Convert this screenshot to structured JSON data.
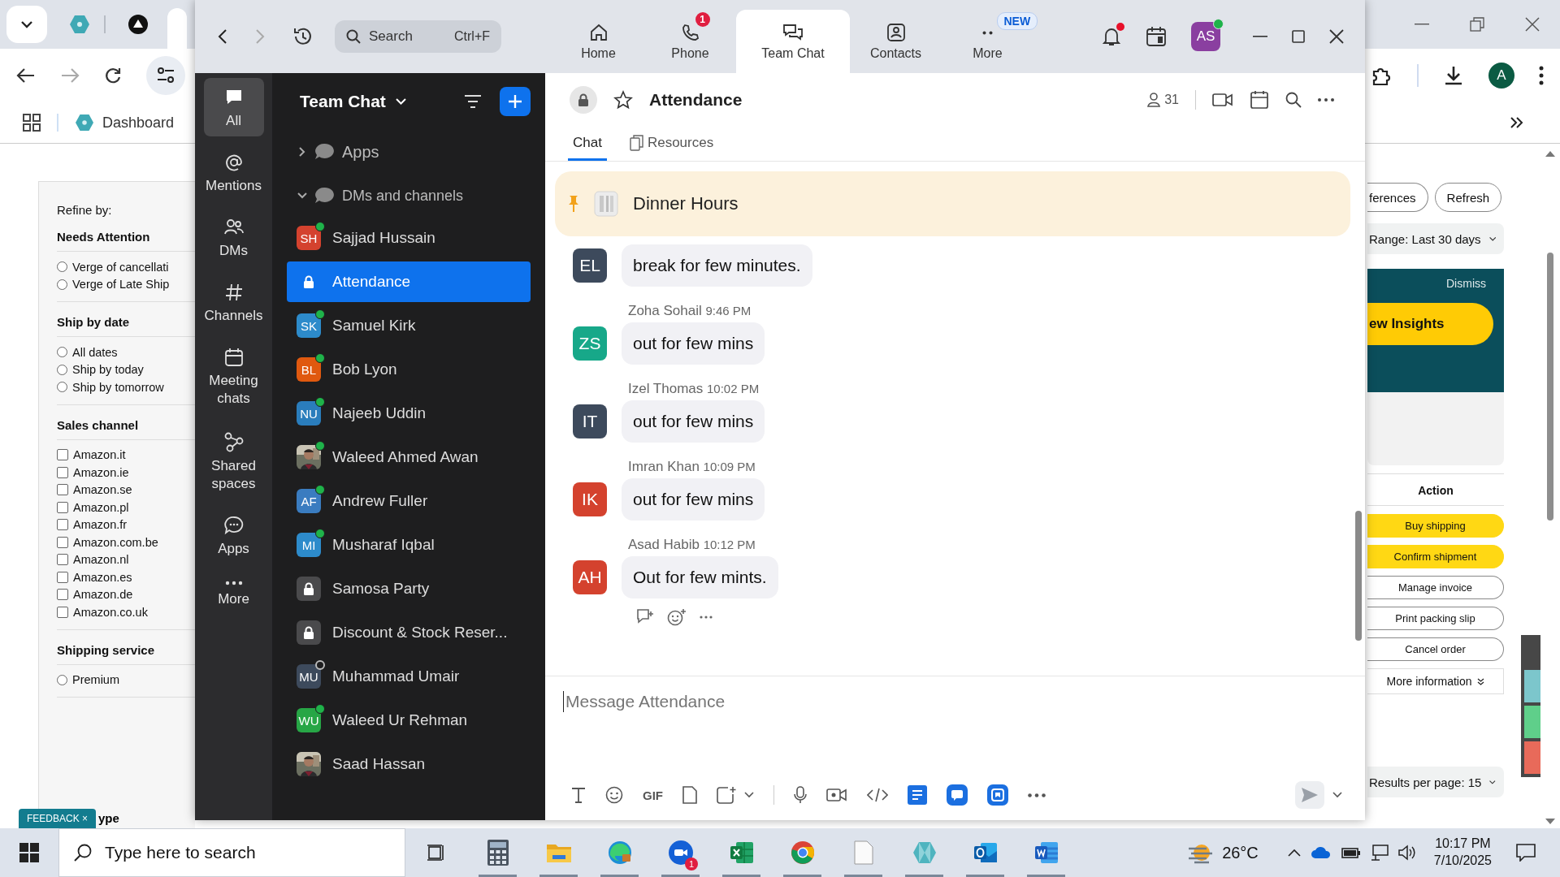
{
  "browser": {
    "tabs": [
      {
        "kind": "hexagon",
        "selected": false
      },
      {
        "kind": "triangle",
        "selected": false
      },
      {
        "kind": "blank",
        "selected": true
      }
    ],
    "bookmarks": [
      {
        "label": "Dashboard"
      }
    ],
    "profile": "A"
  },
  "seller_page": {
    "refine_title": "Refine by:",
    "filter_groups": [
      {
        "title": "Needs Attention",
        "kind": "radio",
        "options": [
          {
            "label": "Verge of cancellati",
            "checked": false
          },
          {
            "label": "Verge of Late Ship",
            "checked": false
          }
        ]
      },
      {
        "title": "Ship by date",
        "kind": "radio",
        "options": [
          {
            "label": "All dates",
            "checked": false
          },
          {
            "label": "Ship by today",
            "checked": false
          },
          {
            "label": "Ship by tomorrow",
            "checked": false
          }
        ]
      },
      {
        "title": "Sales channel",
        "kind": "checkbox",
        "options": [
          {
            "label": "Amazon.it",
            "checked": false
          },
          {
            "label": "Amazon.ie",
            "checked": false
          },
          {
            "label": "Amazon.se",
            "checked": false
          },
          {
            "label": "Amazon.pl",
            "checked": false
          },
          {
            "label": "Amazon.fr",
            "checked": false
          },
          {
            "label": "Amazon.com.be",
            "checked": false
          },
          {
            "label": "Amazon.nl",
            "checked": false
          },
          {
            "label": "Amazon.es",
            "checked": false
          },
          {
            "label": "Amazon.de",
            "checked": false
          },
          {
            "label": "Amazon.co.uk",
            "checked": false
          }
        ]
      },
      {
        "title": "Shipping service",
        "kind": "radio",
        "options": [
          {
            "label": "Premium",
            "checked": false
          }
        ]
      }
    ],
    "last_heading": "ype",
    "feedback": {
      "label": "FEEDBACK",
      "close": "×"
    },
    "top_buttons": [
      {
        "label": "ferences"
      },
      {
        "label": "Refresh"
      }
    ],
    "date_range": "Range: Last 30 days",
    "banner": {
      "dismiss": "Dismiss",
      "cta": "ew Insights"
    },
    "action_header": "Action",
    "actions": [
      {
        "label": "Buy shipping",
        "kind": "primary"
      },
      {
        "label": "Confirm shipment",
        "kind": "primary"
      },
      {
        "label": "Manage invoice",
        "kind": "secondary"
      },
      {
        "label": "Print packing slip",
        "kind": "secondary"
      },
      {
        "label": "Cancel order",
        "kind": "secondary"
      },
      {
        "label": "More information",
        "kind": "expander"
      }
    ],
    "results_per_page": "Results per page: 15"
  },
  "zoom": {
    "search": {
      "placeholder": "Search",
      "shortcut": "Ctrl+F"
    },
    "nav_tabs": [
      {
        "label": "Home",
        "kind": "home",
        "selected": false
      },
      {
        "label": "Phone",
        "kind": "phone",
        "selected": false,
        "badge": {
          "text": "1",
          "kind": "count"
        }
      },
      {
        "label": "Team Chat",
        "kind": "chat",
        "selected": true
      },
      {
        "label": "Contacts",
        "kind": "contacts",
        "selected": false
      },
      {
        "label": "More",
        "kind": "more",
        "selected": false,
        "badge": {
          "text": "NEW",
          "kind": "new"
        }
      }
    ],
    "notifications": {
      "unread": true
    },
    "user": {
      "initials": "AS",
      "color": "#8a3fa0",
      "online": true
    },
    "rail": [
      {
        "label": "All",
        "kind": "all",
        "selected": true
      },
      {
        "label": "Mentions",
        "kind": "mentions",
        "selected": false
      },
      {
        "label": "DMs",
        "kind": "dms",
        "selected": false
      },
      {
        "label": "Channels",
        "kind": "channels",
        "selected": false
      },
      {
        "label": "Meeting chats",
        "kind": "meetings",
        "selected": false
      },
      {
        "label": "Shared spaces",
        "kind": "shared",
        "selected": false
      },
      {
        "label": "Apps",
        "kind": "apps",
        "selected": false
      },
      {
        "label": "More",
        "kind": "more",
        "selected": false
      }
    ],
    "list_title": "Team Chat",
    "sections": [
      {
        "label": "Apps",
        "expanded": false
      },
      {
        "label": "DMs and channels",
        "expanded": true,
        "children": [
          {
            "name": "Sajjad Hussain",
            "kind": "avatar",
            "initials": "SH",
            "color": "#d4422e",
            "online": true,
            "selected": false
          },
          {
            "name": "Attendance",
            "kind": "private",
            "selected": true
          },
          {
            "name": "Samuel Kirk",
            "kind": "avatar",
            "initials": "SK",
            "color": "#2d8bcb",
            "online": true,
            "selected": false
          },
          {
            "name": "Bob Lyon",
            "kind": "avatar",
            "initials": "BL",
            "color": "#e0590f",
            "online": true,
            "selected": false
          },
          {
            "name": "Najeeb Uddin",
            "kind": "avatar",
            "initials": "NU",
            "color": "#2a7dbc",
            "online": true,
            "selected": false
          },
          {
            "name": "Waleed Ahmed Awan",
            "online": true,
            "selected": false
          },
          {
            "name": "Andrew Fuller",
            "kind": "avatar",
            "initials": "AF",
            "color": "#3a7cc0",
            "online": true,
            "selected": false
          },
          {
            "name": "Musharaf Iqbal",
            "kind": "avatar",
            "initials": "MI",
            "color": "#2d8bcb",
            "online": true,
            "selected": false
          },
          {
            "name": "Samosa Party",
            "kind": "private",
            "selected": false
          },
          {
            "name": "Discount & Stock Reser...",
            "kind": "private",
            "selected": false
          },
          {
            "name": "Muhammad Umair",
            "kind": "avatar",
            "initials": "MU",
            "color": "#3d4a5c",
            "online": false,
            "selected": false
          },
          {
            "name": "Waleed Ur Rehman",
            "kind": "avatar",
            "initials": "WU",
            "color": "#27a646",
            "online": true,
            "selected": false
          },
          {
            "name": "Saad Hassan",
            "selected": false
          }
        ]
      }
    ],
    "conversation": {
      "title": "Attendance",
      "starred": false,
      "members": "31",
      "tabs": [
        {
          "label": "Chat",
          "selected": true
        },
        {
          "label": "Resources",
          "selected": false
        }
      ],
      "pinned": "Dinner Hours",
      "messages": [
        {
          "initials": "EL",
          "color": "#3d4a5c",
          "text": "break for few minutes."
        },
        {
          "author": "Zoha Sohail",
          "time": "9:46 PM",
          "initials": "ZS",
          "color": "#17a889",
          "text": "out for few mins"
        },
        {
          "author": "Izel Thomas",
          "time": "10:02 PM",
          "initials": "IT",
          "color": "#3d4a5c",
          "text": "out for few mins"
        },
        {
          "author": "Imran Khan",
          "time": "10:09 PM",
          "initials": "IK",
          "color": "#d4422e",
          "text": "out for few mins"
        },
        {
          "author": "Asad Habib",
          "time": "10:12 PM",
          "initials": "AH",
          "color": "#d4422e",
          "text": "Out for few mints."
        }
      ],
      "composer": {
        "placeholder": "Message Attendance",
        "gif": "GIF"
      }
    }
  },
  "taskbar": {
    "search_placeholder": "Type here to search",
    "apps": [
      {
        "kind": "calculator"
      },
      {
        "kind": "folder"
      },
      {
        "kind": "edge"
      },
      {
        "kind": "zoom",
        "badge": "1"
      },
      {
        "kind": "excel"
      },
      {
        "kind": "chrome"
      },
      {
        "kind": "file"
      },
      {
        "kind": "gem"
      },
      {
        "kind": "outlook"
      },
      {
        "kind": "word"
      }
    ],
    "weather": "26°C",
    "time": "10:17 PM",
    "date": "7/10/2025"
  }
}
